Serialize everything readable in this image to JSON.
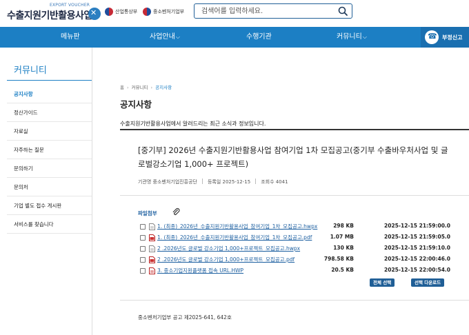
{
  "header": {
    "logo_sub": "EXPORT VOUCHER",
    "logo_main": "수출지원기반활용사업",
    "ministries": [
      "산업통상부",
      "중소벤처기업부"
    ],
    "search_placeholder": "검색어를 입력하세요."
  },
  "nav": {
    "items": [
      "메뉴판",
      "사업안내",
      "수행기관",
      "커뮤니티"
    ],
    "report_label": "부정신고"
  },
  "sidebar": {
    "title": "커뮤니티",
    "items": [
      "공지사항",
      "정산가이드",
      "자료실",
      "자주하는 질문",
      "문의하기",
      "문의처",
      "기업 별도 접수 게시판",
      "서비스를 찾습니다"
    ],
    "active_index": 0
  },
  "breadcrumb": [
    "홈",
    "커뮤니티",
    "공지사항"
  ],
  "page": {
    "title": "공지사항",
    "description": "수출지원기반활용사업에서 알려드리는 최근 소식과 정보입니다."
  },
  "post": {
    "title": "[중기부] 2026년 수출지원기반활용사업 참여기업 1차 모집공고(중기부 수출바우처사업 및 글로벌강소기업 1,000+ 프로젝트)",
    "agency": "기관명 중소벤처기업진흥공단",
    "registered": "등록일 2025-12-15",
    "views": "조회수 4041"
  },
  "attachments": {
    "label": "파일첨부",
    "files": [
      {
        "name": "1. (최종)_2026년_수출지원기반활용사업_참여기업_1차_모집공고.hwpx",
        "size": "298 KB",
        "date": "2025-12-15 21:59:00.0",
        "icon": "hwp-file-icon"
      },
      {
        "name": "1. (최종)_2026년_수출지원기반활용사업_참여기업_1차_모집공고.pdf",
        "size": "1.07 MB",
        "date": "2025-12-15 21:59:05.0",
        "icon": "pdf-file-icon"
      },
      {
        "name": "2 .2026년도 글로벌 강소기업 1,000+프로젝트_모집공고.hwpx",
        "size": "130 KB",
        "date": "2025-12-15 21:59:10.0",
        "icon": "hwp-file-icon"
      },
      {
        "name": "2 .2026년도 글로벌 강소기업 1,000+프로젝트_모집공고.pdf",
        "size": "798.58 KB",
        "date": "2025-12-15 22:00:46.0",
        "icon": "pdf-file-icon"
      },
      {
        "name": "3. 중소기업지원플랫폼 접속 URL.HWP",
        "size": "20.5 KB",
        "date": "2025-12-15 22:00:54.0",
        "icon": "hwp-file-icon"
      }
    ],
    "select_all_label": "전체 선택",
    "download_label": "선택 다운로드"
  },
  "notice": "중소벤처기업부 공고 제2025-641, 642호",
  "colors": {
    "nav_bg": "#1c7fc4",
    "link": "#1c5fa0",
    "button": "#1f5e96"
  }
}
